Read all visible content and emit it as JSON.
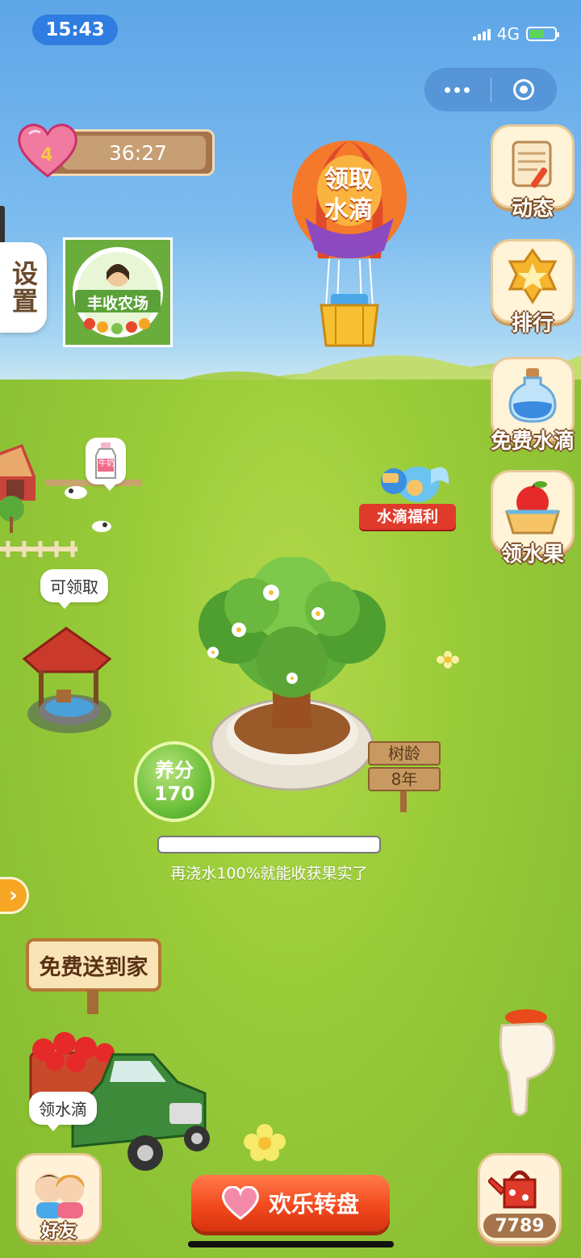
{
  "status_bar": {
    "time": "15:43",
    "network": "4G",
    "battery_level": 0.6
  },
  "hearts": {
    "count": "4",
    "timer": "36:27"
  },
  "settings": {
    "label": "设置"
  },
  "logo": {
    "name": "丰收农场"
  },
  "balloon": {
    "label_line1": "领取",
    "label_line2": "水滴"
  },
  "right_menu": [
    {
      "label": "动态",
      "icon": "scroll-icon"
    },
    {
      "label": "排行",
      "icon": "star-medal-icon"
    },
    {
      "label": "免费水滴",
      "icon": "water-bottle-icon"
    },
    {
      "label": "领水果",
      "icon": "fruit-basket-icon"
    }
  ],
  "milk_bubble": {
    "label": "牛奶"
  },
  "water_bonus": {
    "label": "水滴福利"
  },
  "well": {
    "bubble": "可领取"
  },
  "tree": {
    "age_label": "树龄",
    "age_value": "8年",
    "nutrient_label": "养分",
    "nutrient_value": "170",
    "progress": 0.0,
    "progress_text": "再浇水100%就能收获果实了"
  },
  "delivery": {
    "label": "免费送到家"
  },
  "truck": {
    "bubble": "领水滴"
  },
  "bottom": {
    "friends_label": "好友",
    "wheel_label": "欢乐转盘",
    "water_count": "7789"
  },
  "colors": {
    "accent_orange": "#f24a1e",
    "wood": "#a6744a",
    "grass": "#8fc234",
    "sky": "#5ea6e8"
  }
}
